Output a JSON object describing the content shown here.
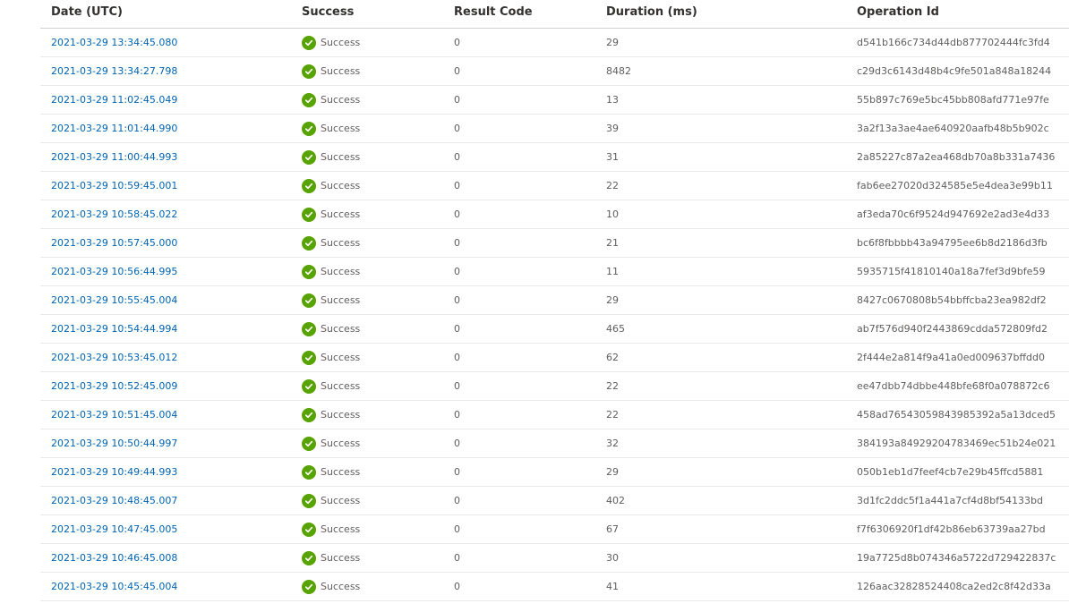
{
  "columns": {
    "date": "Date (UTC)",
    "success": "Success",
    "result_code": "Result Code",
    "duration": "Duration (ms)",
    "operation_id": "Operation Id"
  },
  "colors": {
    "link": "#0063b1",
    "success_icon": "#57a300"
  },
  "rows": [
    {
      "date": "2021-03-29 13:34:45.080",
      "status": "Success",
      "code": "0",
      "duration": "29",
      "op": "d541b166c734d44db877702444fc3fd4"
    },
    {
      "date": "2021-03-29 13:34:27.798",
      "status": "Success",
      "code": "0",
      "duration": "8482",
      "op": "c29d3c6143d48b4c9fe501a848a18244"
    },
    {
      "date": "2021-03-29 11:02:45.049",
      "status": "Success",
      "code": "0",
      "duration": "13",
      "op": "55b897c769e5bc45bb808afd771e97fe"
    },
    {
      "date": "2021-03-29 11:01:44.990",
      "status": "Success",
      "code": "0",
      "duration": "39",
      "op": "3a2f13a3ae4ae640920aafb48b5b902c"
    },
    {
      "date": "2021-03-29 11:00:44.993",
      "status": "Success",
      "code": "0",
      "duration": "31",
      "op": "2a85227c87a2ea468db70a8b331a7436"
    },
    {
      "date": "2021-03-29 10:59:45.001",
      "status": "Success",
      "code": "0",
      "duration": "22",
      "op": "fab6ee27020d324585e5e4dea3e99b11"
    },
    {
      "date": "2021-03-29 10:58:45.022",
      "status": "Success",
      "code": "0",
      "duration": "10",
      "op": "af3eda70c6f9524d947692e2ad3e4d33"
    },
    {
      "date": "2021-03-29 10:57:45.000",
      "status": "Success",
      "code": "0",
      "duration": "21",
      "op": "bc6f8fbbbb43a94795ee6b8d2186d3fb"
    },
    {
      "date": "2021-03-29 10:56:44.995",
      "status": "Success",
      "code": "0",
      "duration": "11",
      "op": "5935715f41810140a18a7fef3d9bfe59"
    },
    {
      "date": "2021-03-29 10:55:45.004",
      "status": "Success",
      "code": "0",
      "duration": "29",
      "op": "8427c0670808b54bbffcba23ea982df2"
    },
    {
      "date": "2021-03-29 10:54:44.994",
      "status": "Success",
      "code": "0",
      "duration": "465",
      "op": "ab7f576d940f2443869cdda572809fd2"
    },
    {
      "date": "2021-03-29 10:53:45.012",
      "status": "Success",
      "code": "0",
      "duration": "62",
      "op": "2f444e2a814f9a41a0ed009637bffdd0"
    },
    {
      "date": "2021-03-29 10:52:45.009",
      "status": "Success",
      "code": "0",
      "duration": "22",
      "op": "ee47dbb74dbbe448bfe68f0a078872c6"
    },
    {
      "date": "2021-03-29 10:51:45.004",
      "status": "Success",
      "code": "0",
      "duration": "22",
      "op": "458ad76543059843985392a5a13dced5"
    },
    {
      "date": "2021-03-29 10:50:44.997",
      "status": "Success",
      "code": "0",
      "duration": "32",
      "op": "384193a84929204783469ec51b24e021"
    },
    {
      "date": "2021-03-29 10:49:44.993",
      "status": "Success",
      "code": "0",
      "duration": "29",
      "op": "050b1eb1d7feef4cb7e29b45ffcd5881"
    },
    {
      "date": "2021-03-29 10:48:45.007",
      "status": "Success",
      "code": "0",
      "duration": "402",
      "op": "3d1fc2ddc5f1a441a7cf4d8bf54133bd"
    },
    {
      "date": "2021-03-29 10:47:45.005",
      "status": "Success",
      "code": "0",
      "duration": "67",
      "op": "f7f6306920f1df42b86eb63739aa27bd"
    },
    {
      "date": "2021-03-29 10:46:45.008",
      "status": "Success",
      "code": "0",
      "duration": "30",
      "op": "19a7725d8b074346a5722d729422837c"
    },
    {
      "date": "2021-03-29 10:45:45.004",
      "status": "Success",
      "code": "0",
      "duration": "41",
      "op": "126aac32828524408ca2ed2c8f42d33a"
    }
  ]
}
